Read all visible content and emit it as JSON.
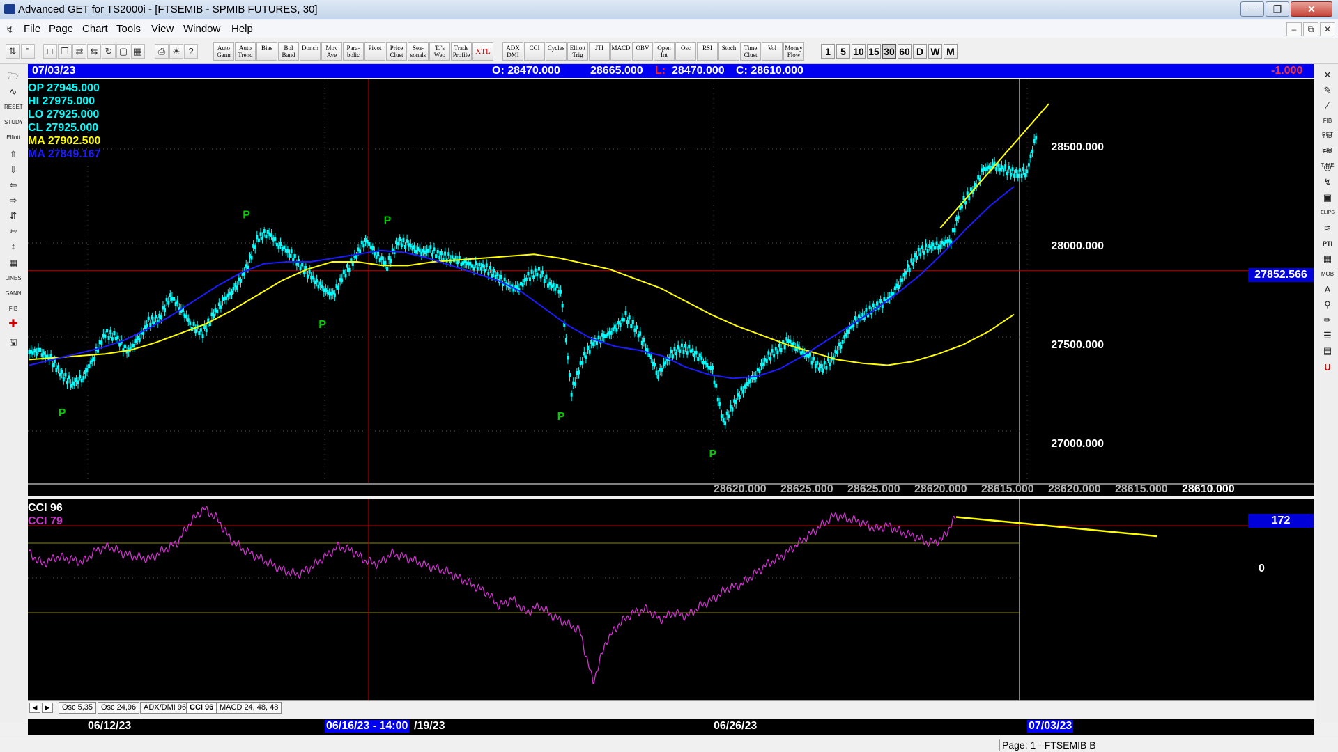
{
  "window": {
    "title": "Advanced GET for TS2000i - [FTSEMIB - SPMIB FUTURES, 30]"
  },
  "menu": [
    "File",
    "Page",
    "Chart",
    "Tools",
    "View",
    "Window",
    "Help"
  ],
  "toolbar": {
    "study_buttons": [
      "Auto Gann",
      "Auto Trend",
      "Bias",
      "Bol Band",
      "Donch",
      "Mov Ave",
      "Para-bolic",
      "Pivot",
      "Price Clust",
      "Sea-sonals",
      "TJ's Web",
      "Trade Profile",
      "XTL",
      "ADX DMI",
      "CCI",
      "Cycles",
      "Elliott Trig",
      "JTI",
      "MACD",
      "OBV",
      "Open Int",
      "Osc",
      "RSI",
      "Stoch",
      "Time Clust",
      "Vol",
      "Money Flow"
    ],
    "timeframes": [
      "1",
      "5",
      "10",
      "15",
      "30",
      "60",
      "D",
      "W",
      "M"
    ],
    "active_timeframe": "30"
  },
  "left_tools": [
    "STUDY",
    "Elliott",
    "RESET",
    "LINES",
    "GANN",
    "FIB"
  ],
  "right_tools": [
    "FIB RET",
    "FIB EXT",
    "FIB TIME",
    "ELIPS",
    "PTI",
    "MOB"
  ],
  "header": {
    "date": "07/03/23",
    "open": "O: 28470.000",
    "high": "28665.000",
    "low_label": "L:",
    "low": "28470.000",
    "close": "C: 28610.000",
    "change": "-1.000"
  },
  "readouts": {
    "op": "OP  27945.000",
    "hi": "HI   27975.000",
    "lo": "LO  27925.000",
    "cl": "CL  27925.000",
    "ma1": "MA  27902.500",
    "ma2": "MA  27849.167"
  },
  "colors": {
    "candles": "#00ffff",
    "ma_fast": "#ffff00",
    "ma_slow": "#1c1cff",
    "pivot": "#00cc00",
    "cursor": "#c00000",
    "cci": "#cc33cc",
    "readout_cyan": "#00ffff",
    "readout_yellow": "#ffff00",
    "readout_blue": "#1c1cff",
    "header_bg": "#0000f0",
    "low_label": "#ff2020",
    "change": "#ff3030"
  },
  "price_axis": {
    "labels": [
      "28500.000",
      "28000.000",
      "27500.000",
      "27000.000"
    ],
    "cursor_tag": "27852.566",
    "bottom_values": [
      "28620.000",
      "28625.000",
      "28625.000",
      "28620.000",
      "28615.000",
      "28620.000",
      "28615.000",
      "28610.000"
    ]
  },
  "pivot_label": "P",
  "cci": {
    "label1": "CCI 96",
    "label2": "CCI  79",
    "tag": "172",
    "zero_label": "0"
  },
  "tabs": [
    "Osc 5,35",
    "Osc 24,96",
    "ADX/DMI 96",
    "CCI 96",
    "MACD 24, 48, 48"
  ],
  "date_axis": {
    "d1": "06/12/23",
    "cursor": "06/16/23 - 14:00",
    "d2": "/19/23",
    "d3": "06/26/23",
    "d4": "07/03/23"
  },
  "status": {
    "page": "Page: 1 - FTSEMIB B"
  },
  "chart_data": {
    "type": "line",
    "price_ylim": [
      26800,
      28800
    ],
    "price_ticks": [
      27000,
      27500,
      28000,
      28500
    ],
    "cursor_price": 27852.566,
    "close_series": [
      27420,
      27380,
      27300,
      27250,
      27290,
      27400,
      27520,
      27500,
      27420,
      27480,
      27580,
      27600,
      27720,
      27650,
      27560,
      27520,
      27620,
      27700,
      27760,
      27860,
      28020,
      28060,
      27990,
      27950,
      27880,
      27820,
      27760,
      27720,
      27830,
      27920,
      28020,
      27940,
      27880,
      28010,
      27990,
      27950,
      27960,
      27930,
      27920,
      27900,
      27880,
      27870,
      27830,
      27780,
      27750,
      27820,
      27850,
      27780,
      27750,
      27210,
      27380,
      27470,
      27500,
      27540,
      27610,
      27540,
      27430,
      27300,
      27400,
      27440,
      27430,
      27380,
      27320,
      27040,
      27150,
      27240,
      27300,
      27390,
      27430,
      27480,
      27430,
      27390,
      27330,
      27380,
      27480,
      27580,
      27620,
      27660,
      27690,
      27760,
      27860,
      27950,
      27980,
      27990,
      28020,
      28210,
      28280,
      28390,
      28410,
      28390,
      28370,
      28380,
      28610
    ],
    "ma_fast": [
      27380,
      27390,
      27400,
      27410,
      27430,
      27470,
      27520,
      27570,
      27640,
      27720,
      27800,
      27860,
      27900,
      27900,
      27880,
      27880,
      27900,
      27910,
      27920,
      27930,
      27940,
      27920,
      27890,
      27860,
      27810,
      27760,
      27690,
      27620,
      27560,
      27510,
      27460,
      27420,
      27380,
      27360,
      27350,
      27370,
      27410,
      27460,
      27530,
      27620,
      27720,
      27830,
      27940,
      28060,
      28160
    ],
    "ma_slow": [
      27350,
      27380,
      27410,
      27440,
      27480,
      27540,
      27610,
      27690,
      27770,
      27840,
      27890,
      27900,
      27900,
      27920,
      27940,
      27960,
      27950,
      27920,
      27880,
      27840,
      27800,
      27740,
      27650,
      27560,
      27490,
      27450,
      27430,
      27400,
      27340,
      27300,
      27280,
      27290,
      27330,
      27400,
      27480,
      27560,
      27640,
      27730,
      27830,
      27950,
      28080,
      28200,
      28300
    ],
    "pivots": [
      {
        "index": 3,
        "price": 27160,
        "type": "low"
      },
      {
        "index": 20,
        "price": 28110,
        "type": "high"
      },
      {
        "index": 27,
        "price": 27630,
        "type": "low"
      },
      {
        "index": 33,
        "price": 28080,
        "type": "high"
      },
      {
        "index": 49,
        "price": 27140,
        "type": "low"
      },
      {
        "index": 63,
        "price": 26940,
        "type": "low"
      }
    ],
    "trendline": [
      {
        "index": 84,
        "price": 28080
      },
      {
        "index": 94,
        "price": 28740
      }
    ],
    "cci_series": [
      70,
      40,
      60,
      55,
      45,
      80,
      90,
      70,
      60,
      55,
      80,
      100,
      160,
      200,
      170,
      110,
      80,
      60,
      40,
      20,
      10,
      30,
      60,
      90,
      80,
      50,
      40,
      70,
      60,
      45,
      30,
      20,
      0,
      -20,
      -40,
      -80,
      -60,
      -100,
      -80,
      -110,
      -130,
      -150,
      -300,
      -180,
      -130,
      -100,
      -90,
      -120,
      -100,
      -110,
      -80,
      -60,
      -30,
      -20,
      10,
      40,
      60,
      90,
      120,
      150,
      180,
      170,
      160,
      140,
      150,
      130,
      120,
      100,
      110,
      172
    ],
    "cci_ylim": [
      -340,
      220
    ],
    "cci_levels": [
      150,
      100,
      0,
      -100
    ],
    "cci_trendline": [
      {
        "index": 0.74,
        "value": 175
      },
      {
        "index": 0.9,
        "value": 120
      }
    ]
  }
}
